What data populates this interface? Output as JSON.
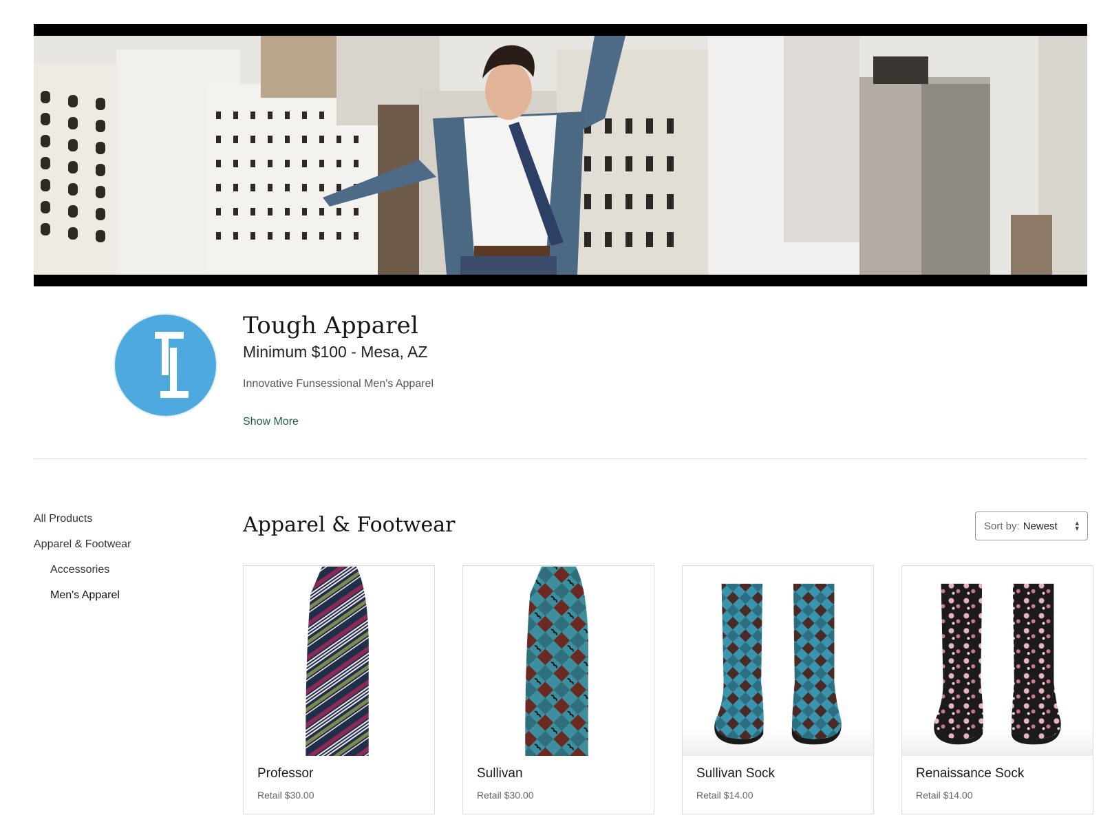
{
  "store": {
    "name": "Tough Apparel",
    "meta": "Minimum $100 - Mesa, AZ",
    "tagline": "Innovative Funsessional Men's Apparel",
    "show_more": "Show More",
    "brand_color": "#4ea9de"
  },
  "sidebar": {
    "items": [
      {
        "label": "All Products",
        "level": 0,
        "active": false
      },
      {
        "label": "Apparel & Footwear",
        "level": 0,
        "active": false
      },
      {
        "label": "Accessories",
        "level": 1,
        "active": false
      },
      {
        "label": "Men's Apparel",
        "level": 1,
        "active": true
      }
    ]
  },
  "section": {
    "title": "Apparel & Footwear",
    "sort_prefix": "Sort by:",
    "sort_value": "Newest"
  },
  "products": [
    {
      "name": "Professor",
      "price": "Retail $30.00",
      "image": "striped-tie"
    },
    {
      "name": "Sullivan",
      "price": "Retail $30.00",
      "image": "plaid-tie"
    },
    {
      "name": "Sullivan Sock",
      "price": "Retail $14.00",
      "image": "plaid-socks"
    },
    {
      "name": "Renaissance Sock",
      "price": "Retail $14.00",
      "image": "floral-socks"
    }
  ]
}
